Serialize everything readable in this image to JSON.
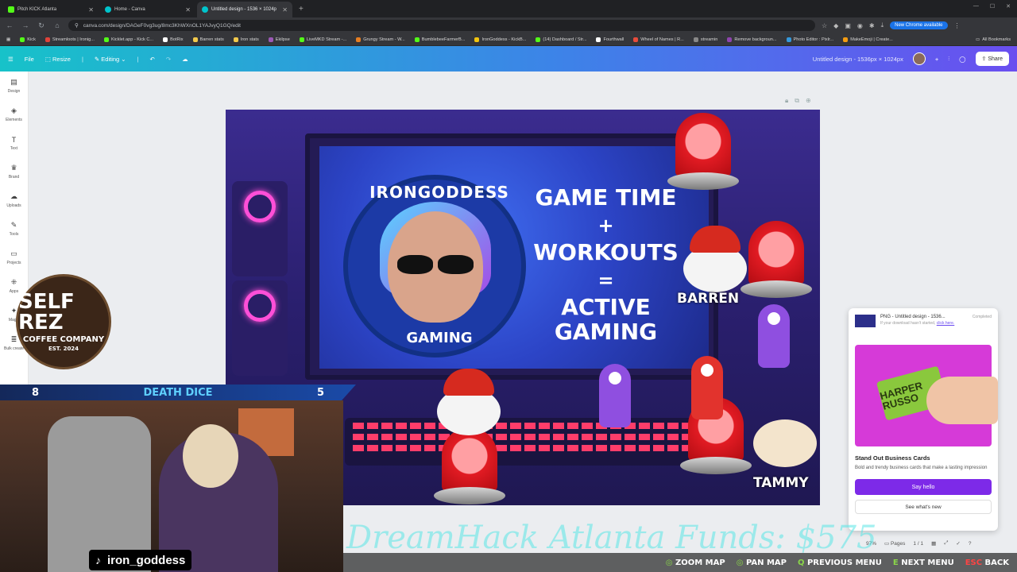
{
  "browser": {
    "tabs": [
      {
        "label": "Pitch KICK Atlanta",
        "color": "#53fc18"
      },
      {
        "label": "Home - Canva",
        "color": "#00c4cc"
      },
      {
        "label": "Untitled design - 1536 × 1024p",
        "color": "#00c4cc"
      }
    ],
    "url": "canva.com/design/DAGeF0vg3ug/8mc3KhWXnOL1YAJvyQ1GQ/edit",
    "new_chrome_label": "New Chrome available",
    "bookmarks": [
      "Kick",
      "Streamloots | Ironig...",
      "Kicklet.app - Kick C...",
      "BotRix",
      "Barren stats",
      "Iron stats",
      "Ekilpse",
      "LiveMKD Stream -...",
      "Grungy Stream - W...",
      "BumblebeeFarmerB...",
      "IronGoddess - KickB...",
      "(14) Dashboard / Str...",
      "Fourthwall",
      "Wheel of Names | R...",
      "streamin",
      "Remove backgroun...",
      "Photo Editor : Pixlr...",
      "MakeEmoji | Create..."
    ],
    "all_bookmarks": "All Bookmarks"
  },
  "canva": {
    "menu": [
      "File",
      "Resize",
      "Editing"
    ],
    "doc_title": "Untitled design - 1536px × 1024px",
    "share_label": "Share",
    "sidebar": [
      {
        "label": "Design",
        "icon": "layout-icon"
      },
      {
        "label": "Elements",
        "icon": "shapes-icon"
      },
      {
        "label": "Text",
        "icon": "text-icon"
      },
      {
        "label": "Brand",
        "icon": "crown-icon"
      },
      {
        "label": "Uploads",
        "icon": "cloud-upload-icon"
      },
      {
        "label": "Tools",
        "icon": "pen-icon"
      },
      {
        "label": "Projects",
        "icon": "folder-icon"
      },
      {
        "label": "Apps",
        "icon": "apps-grid-icon"
      },
      {
        "label": "Magic",
        "icon": "sparkle-icon"
      },
      {
        "label": "Bulk create",
        "icon": "stack-icon"
      }
    ]
  },
  "design": {
    "logo_top": "IRONGODDESS",
    "logo_bottom": "GAMING",
    "headline": [
      "GAME TIME",
      "+",
      "WORKOUTS",
      "=",
      "ACTIVE GAMING"
    ],
    "tag_barren": "BARREN",
    "tag_tammy": "TAMMY"
  },
  "popup": {
    "file_title": "PNG - Untitled design - 1536...",
    "status": "Completed",
    "sub": "If your download hasn't started,",
    "sub_link": "click here.",
    "card_text": "HARPER RUSSO",
    "promo_title": "Stand Out Business Cards",
    "promo_desc": "Bold and trendy business cards that make a lasting impression",
    "say_hello": "Say hello",
    "see_new": "See what's new"
  },
  "bottom_controls": {
    "zoom": "97%",
    "pages_label": "Pages",
    "pages_count": "1 / 1"
  },
  "stream": {
    "left_score": "8",
    "bar_title": "DEATH DICE",
    "right_score": "5",
    "coffee_top": "SELF REZ",
    "coffee_mid": "COFFEE COMPANY",
    "coffee_small": "EST. 2024",
    "handle": "iron_goddess",
    "ticker": "DreamHack Atlanta Funds: $575",
    "hud": {
      "zoom_map": "ZOOM MAP",
      "pan_map": "PAN MAP",
      "previous_menu": "PREVIOUS MENU",
      "next_menu": "NEXT MENU",
      "esc": "ESC",
      "back": "BACK",
      "q_key": "Q",
      "e_key": "E"
    }
  }
}
